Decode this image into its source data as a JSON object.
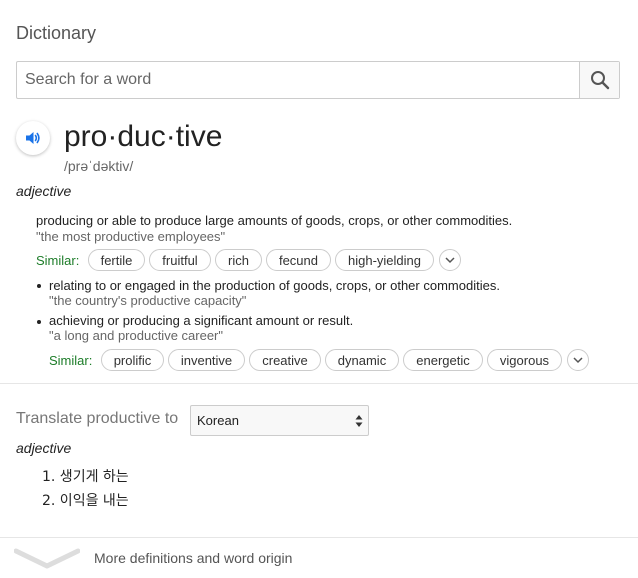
{
  "header": {
    "title": "Dictionary"
  },
  "search": {
    "placeholder": "Search for a word"
  },
  "entry": {
    "word": "pro·duc·tive",
    "phonetic": "/prəˈdəktiv/",
    "part_of_speech": "adjective"
  },
  "senses": [
    {
      "definition": "producing or able to produce large amounts of goods, crops, or other commodities.",
      "example": "\"the most productive employees\"",
      "similar_label": "Similar:",
      "similar": [
        "fertile",
        "fruitful",
        "rich",
        "fecund",
        "high-yielding"
      ]
    },
    {
      "definition": "relating to or engaged in the production of goods, crops, or other commodities.",
      "example": "\"the country's productive capacity\""
    },
    {
      "definition": "achieving or producing a significant amount or result.",
      "example": "\"a long and productive career\"",
      "similar_label": "Similar:",
      "similar": [
        "prolific",
        "inventive",
        "creative",
        "dynamic",
        "energetic",
        "vigorous"
      ]
    }
  ],
  "translate": {
    "label": "Translate productive to",
    "language": "Korean",
    "part_of_speech": "adjective",
    "items": [
      "1. 생기게 하는",
      "2. 이익을 내는"
    ]
  },
  "footer": {
    "more_label": "More definitions and word origin"
  },
  "colors": {
    "accent": "#1a73e8",
    "similar_green": "#1e7d2a"
  },
  "icons": {
    "search": "search-icon",
    "speaker": "speaker-icon",
    "expand": "chevron-down-icon"
  }
}
